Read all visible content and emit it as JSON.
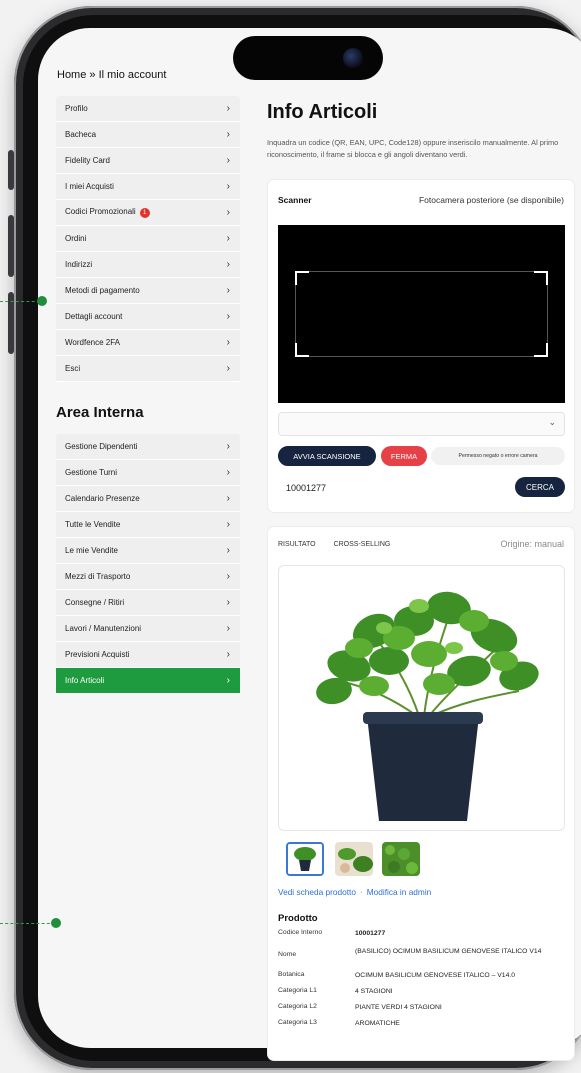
{
  "breadcrumb": "Home » Il mio account",
  "account_menu": [
    {
      "label": "Profilo"
    },
    {
      "label": "Bacheca"
    },
    {
      "label": "Fidelity Card"
    },
    {
      "label": "I miei Acquisti"
    },
    {
      "label": "Codici Promozionali",
      "badge": "1"
    },
    {
      "label": "Ordini"
    },
    {
      "label": "Indirizzi"
    },
    {
      "label": "Metodi di pagamento"
    },
    {
      "label": "Dettagli account"
    },
    {
      "label": "Wordfence 2FA"
    },
    {
      "label": "Esci"
    }
  ],
  "internal_title": "Area Interna",
  "internal_menu": [
    {
      "label": "Gestione Dipendenti"
    },
    {
      "label": "Gestione Turni"
    },
    {
      "label": "Calendario Presenze"
    },
    {
      "label": "Tutte le Vendite"
    },
    {
      "label": "Le mie Vendite"
    },
    {
      "label": "Mezzi di Trasporto"
    },
    {
      "label": "Consegne / Ritiri"
    },
    {
      "label": "Lavori / Manutenzioni"
    },
    {
      "label": "Previsioni Acquisti"
    },
    {
      "label": "Info Articoli",
      "active": true
    }
  ],
  "chevron": "›",
  "page": {
    "title": "Info Articoli",
    "description": "Inquadra un codice (QR, EAN, UPC, Code128) oppure inseriscilo manualmente. Al primo riconoscimento, il frame si blocca e gli angoli diventano verdi."
  },
  "scanner": {
    "label": "Scanner",
    "camera": "Fotocamera posteriore (se disponibile)",
    "start_label": "AVVIA SCANSIONE",
    "stop_label": "FERMA",
    "error": "Permesso negato o errore camera",
    "code_value": "10001277",
    "search_label": "CERCA",
    "select_chevron": "⌄"
  },
  "result": {
    "tab_result": "RISULTATO",
    "tab_cross": "CROSS-SELLING",
    "origin": "Origine: manual",
    "link_view": "Vedi scheda prodotto",
    "link_sep": "·",
    "link_admin": "Modifica in admin",
    "section": "Prodotto",
    "specs": [
      {
        "k": "Codice Interno",
        "v": "10001277",
        "bold": true
      },
      {
        "k": "Nome",
        "v": "(BASILICO) OCIMUM BASILICUM GENOVESE ITALICO V14"
      },
      {
        "k": "Botanica",
        "v": "OCIMUM BASILICUM GENOVESE ITALICO – V14.0"
      },
      {
        "k": "Categoria L1",
        "v": "4 STAGIONI"
      },
      {
        "k": "Categoria L2",
        "v": "PIANTE VERDI 4 STAGIONI"
      },
      {
        "k": "Categoria L3",
        "v": "AROMATICHE"
      }
    ]
  },
  "colors": {
    "accent_green": "#1e9b3f",
    "navy": "#16243f",
    "stop_red": "#e54146",
    "link_blue": "#2e6fd4"
  }
}
